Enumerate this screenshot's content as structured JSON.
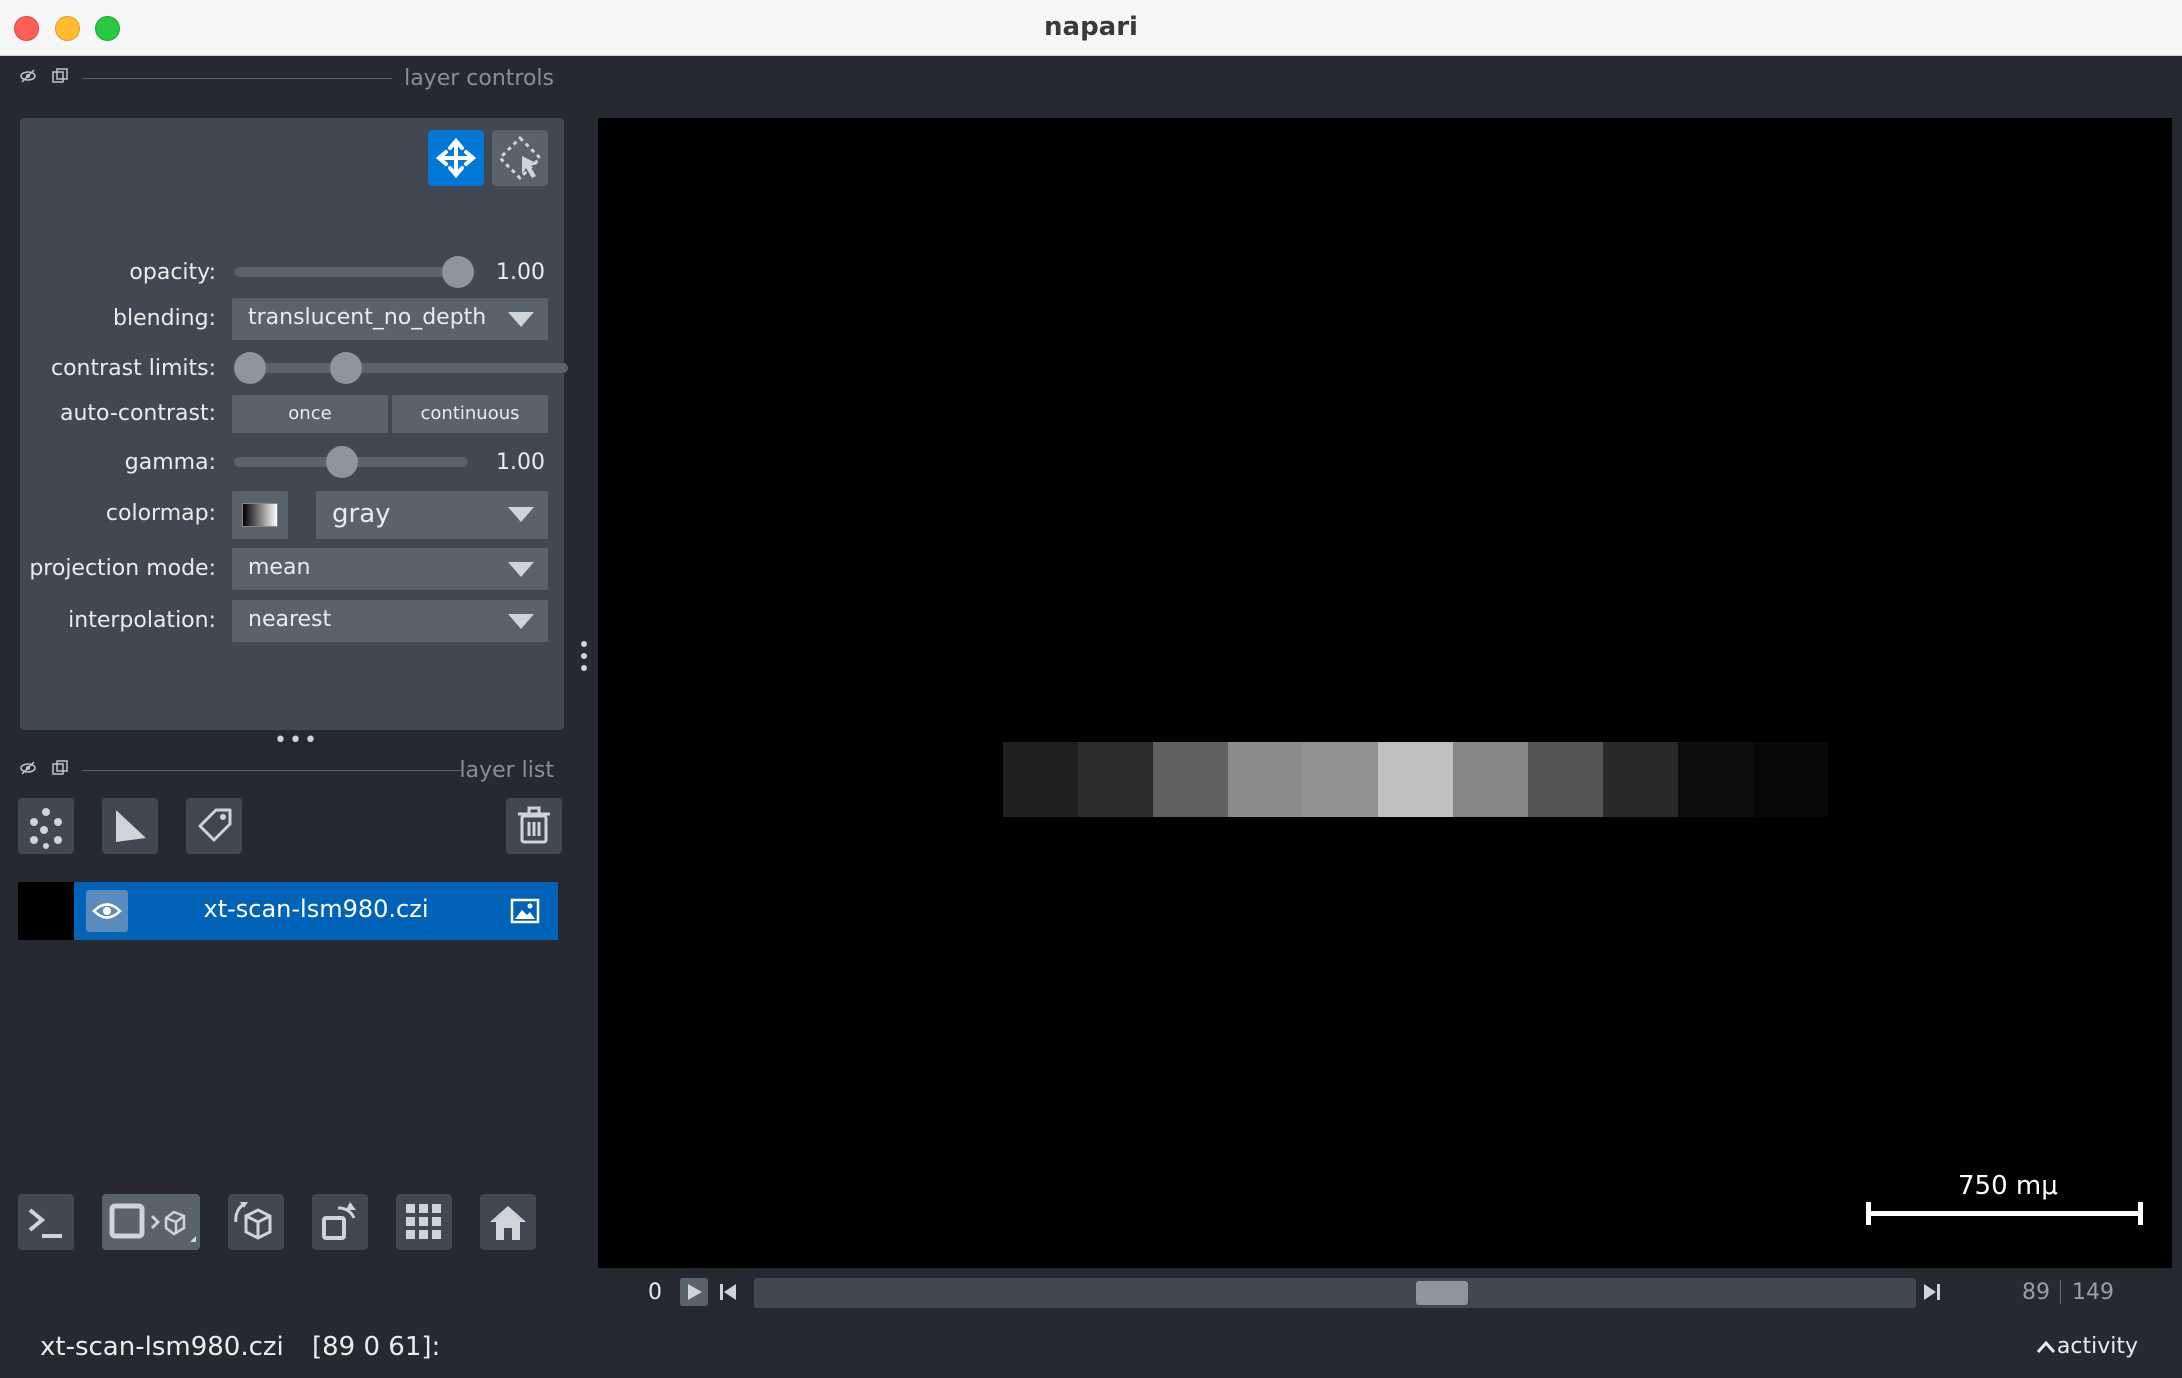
{
  "window": {
    "title": "napari"
  },
  "layer_controls": {
    "title": "layer controls",
    "opacity": {
      "label": "opacity:",
      "value": "1.00",
      "fraction": 1.0
    },
    "blending": {
      "label": "blending:",
      "value": "translucent_no_depth"
    },
    "contrast_limits": {
      "label": "contrast limits:",
      "low_fraction": 0.0,
      "high_fraction": 0.3
    },
    "auto_contrast": {
      "label": "auto-contrast:",
      "once": "once",
      "continuous": "continuous"
    },
    "gamma": {
      "label": "gamma:",
      "value": "1.00",
      "fraction": 0.45
    },
    "colormap": {
      "label": "colormap:",
      "value": "gray"
    },
    "projection_mode": {
      "label": "projection mode:",
      "value": "mean"
    },
    "interpolation": {
      "label": "interpolation:",
      "value": "nearest"
    }
  },
  "layer_list": {
    "title": "layer list",
    "layers": [
      {
        "name": "xt-scan-lsm980.czi",
        "type": "image",
        "visible": true
      }
    ]
  },
  "canvas": {
    "scale_bar": "750 mμ",
    "strip": [
      0.12,
      0.17,
      0.38,
      0.55,
      0.57,
      0.75,
      0.52,
      0.33,
      0.16,
      0.05,
      0.03
    ]
  },
  "dims": {
    "axis_label": "0",
    "current": "89",
    "total": "149",
    "fraction": 0.597
  },
  "status": {
    "layer_name": "xt-scan-lsm980.czi",
    "coords": "[89 0 61]:",
    "activity": "activity"
  },
  "colors": {
    "accent": "#0078d7",
    "layer_selected": "#0063b8",
    "panel": "#414851",
    "background": "#262930"
  }
}
